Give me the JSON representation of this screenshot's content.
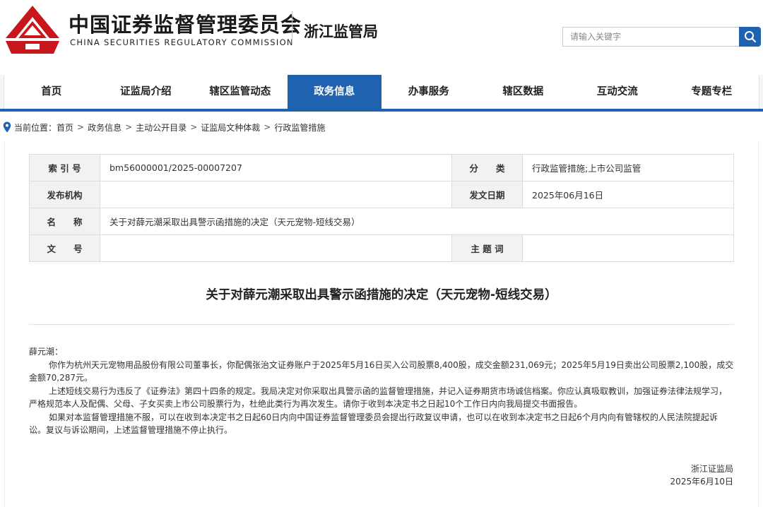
{
  "header": {
    "org_cn": "中国证券监督管理委员会",
    "org_en": "CHINA SECURITIES REGULATORY COMMISSION",
    "bureau": "浙江监管局",
    "search_placeholder": "请输入关键字",
    "brand_color": "#c8161d",
    "accent_color": "#1f63b0"
  },
  "nav": {
    "items": [
      "首页",
      "证监局介绍",
      "辖区监管动态",
      "政务信息",
      "办事服务",
      "辖区数据",
      "互动交流",
      "专题专栏"
    ],
    "active": "政务信息"
  },
  "breadcrumb": {
    "label": "当前位置：",
    "items": [
      "首页",
      "政务信息",
      "主动公开目录",
      "证监局文种体裁",
      "行政监管措施"
    ],
    "separator": ">"
  },
  "meta": {
    "index_label": "索 引 号",
    "index_value": "bm56000001/2025-00007207",
    "category_label": "分　　类",
    "category_value": "行政监管措施;上市公司监管",
    "issuer_label": "发布机构",
    "issuer_value": "",
    "date_label": "发文日期",
    "date_value": "2025年06月16日",
    "name_label": "名　　称",
    "name_value": "关于对薛元潮采取出具警示函措施的决定（天元宠物-短线交易）",
    "docno_label": "文　　号",
    "docno_value": "",
    "subject_label": "主 题 词",
    "subject_value": ""
  },
  "document": {
    "title": "关于对薛元潮采取出具警示函措施的决定（天元宠物-短线交易）",
    "salutation": "薛元潮：",
    "paragraphs": [
      "你作为杭州天元宠物用品股份有限公司董事长，你配偶张治文证券账户于2025年5月16日买入公司股票8,400股，成交金额231,069元；2025年5月19日卖出公司股票2,100股，成交金额70,287元。",
      "上述短线交易行为违反了《证券法》第四十四条的规定。我局决定对你采取出具警示函的监督管理措施，并记入证券期货市场诚信档案。你应认真吸取教训，加强证券法律法规学习，严格规范本人及配偶、父母、子女买卖上市公司股票行为，杜绝此类行为再次发生。请你于收到本决定书之日起10个工作日内向我局提交书面报告。",
      "如果对本监督管理措施不服，可以在收到本决定书之日起60日内向中国证券监督管理委员会提出行政复议申请，也可以在收到本决定书之日起6个月内向有管辖权的人民法院提起诉讼。复议与诉讼期间，上述监督管理措施不停止执行。"
    ],
    "signer": "浙江证监局",
    "sign_date": "2025年6月10日"
  }
}
